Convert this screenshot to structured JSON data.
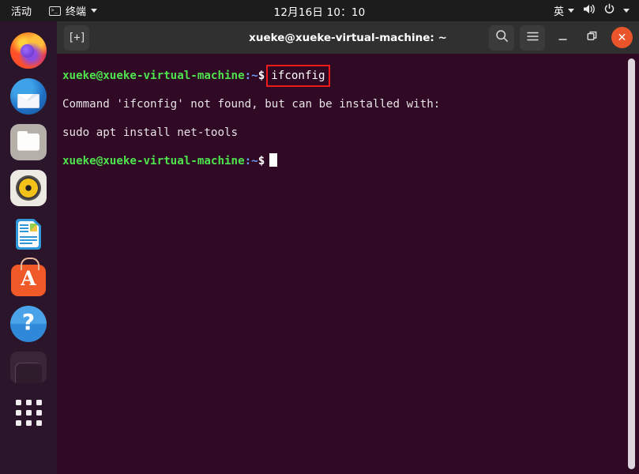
{
  "topbar": {
    "activities": "活动",
    "app_icon": "terminal-icon",
    "app_name": "终端",
    "clock": "12月16日  10：10",
    "input_method": "英",
    "volume_icon": "volume-icon",
    "power_icon": "power-icon",
    "menu_caret_icon": "chevron-down-icon"
  },
  "dock": {
    "items": [
      {
        "name": "firefox",
        "label": "Firefox"
      },
      {
        "name": "thunderbird",
        "label": "Thunderbird Mail"
      },
      {
        "name": "files",
        "label": "Files"
      },
      {
        "name": "rhythmbox",
        "label": "Rhythmbox"
      },
      {
        "name": "libreoffice-writer",
        "label": "LibreOffice Writer"
      },
      {
        "name": "ubuntu-software",
        "label": "Ubuntu Software"
      },
      {
        "name": "help",
        "label": "Help"
      },
      {
        "name": "trash",
        "label": "Trash"
      }
    ],
    "show_apps_label": "Show Applications"
  },
  "window": {
    "title": "xueke@xueke-virtual-machine: ~",
    "new_tab_glyph": "[+]",
    "search_icon": "search-icon",
    "menu_icon": "hamburger-menu-icon",
    "minimize_icon": "minimize-icon",
    "maximize_icon": "maximize-icon",
    "close_icon": "close-icon",
    "close_label": "✕"
  },
  "terminal": {
    "prompt_user": "xueke@xueke-virtual-machine",
    "prompt_path": ":~",
    "prompt_dollar": "$",
    "command": "ifconfig",
    "output_line_1": "Command 'ifconfig' not found, but can be installed with:",
    "output_line_2": "sudo apt install net-tools",
    "highlight_color": "#ee1b1b",
    "bg_color": "#300a24",
    "user_color": "#4ee24e",
    "path_color": "#6f9cf7"
  }
}
